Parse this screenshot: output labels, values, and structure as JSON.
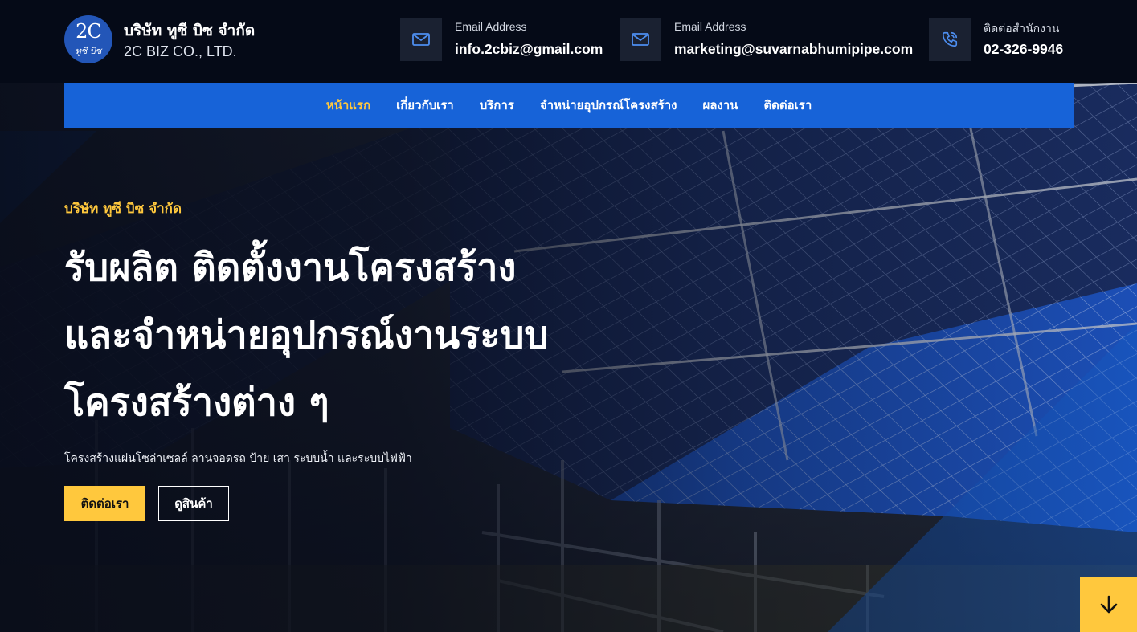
{
  "logo": {
    "mark_top": "2C",
    "mark_bottom": "ทูซี บิซ"
  },
  "brand": {
    "name_th": "บริษัท ทูซี บิซ จำกัด",
    "name_en": "2C BIZ CO., LTD."
  },
  "contacts": [
    {
      "label": "Email Address",
      "value": "info.2cbiz@gmail.com",
      "icon": "envelope-icon"
    },
    {
      "label": "Email Address",
      "value": "marketing@suvarnabhumipipe.com",
      "icon": "envelope-icon"
    },
    {
      "label": "ติดต่อสำนักงาน",
      "value": "02-326-9946",
      "icon": "phone-icon"
    }
  ],
  "nav": {
    "items": [
      {
        "label": "หน้าแรก",
        "active": true
      },
      {
        "label": "เกี่ยวกับเรา",
        "active": false
      },
      {
        "label": "บริการ",
        "active": false
      },
      {
        "label": "จำหน่ายอุปกรณ์โครงสร้าง",
        "active": false
      },
      {
        "label": "ผลงาน",
        "active": false
      },
      {
        "label": "ติดต่อเรา",
        "active": false
      }
    ]
  },
  "hero": {
    "kicker": "บริษัท ทูซี บิซ จำกัด",
    "headline": [
      "รับผลิต ติดตั้งงานโครงสร้าง",
      "และจำหน่ายอุปกรณ์งานระบบ",
      "โครงสร้างต่าง ๆ"
    ],
    "subtitle": "โครงสร้างแผ่นโซล่าเซลล์ ลานจอดรถ ป้าย เสา ระบบน้ำ และระบบไฟฟ้า",
    "primary_button": "ติดต่อเรา",
    "secondary_button": "ดูสินค้า",
    "scroll_icon": "arrow-down-icon"
  },
  "colors": {
    "accent": "#ffc83d",
    "nav_blue": "#1763d8",
    "topbar": "#050a17"
  }
}
